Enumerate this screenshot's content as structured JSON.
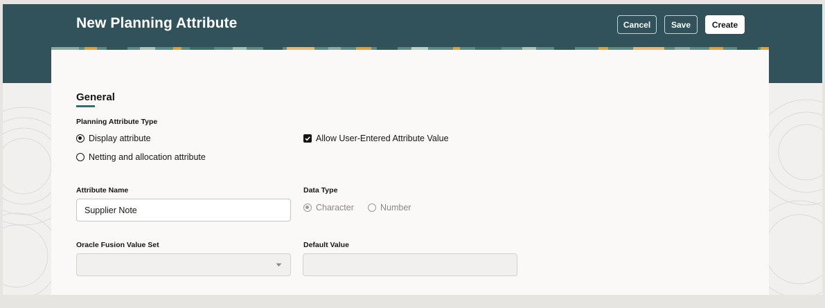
{
  "header": {
    "title": "New Planning Attribute",
    "buttons": {
      "cancel": "Cancel",
      "save": "Save",
      "create": "Create"
    }
  },
  "general": {
    "section_title": "General",
    "planning_attribute_type": {
      "label": "Planning Attribute Type",
      "options": [
        {
          "label": "Display attribute",
          "selected": true
        },
        {
          "label": "Netting and allocation attribute",
          "selected": false
        }
      ]
    },
    "allow_user_entered": {
      "label": "Allow User-Entered Attribute Value",
      "checked": true
    },
    "attribute_name": {
      "label": "Attribute Name",
      "value": "Supplier Note"
    },
    "data_type": {
      "label": "Data Type",
      "options": [
        {
          "label": "Character",
          "selected": true
        },
        {
          "label": "Number",
          "selected": false
        }
      ],
      "disabled": true
    },
    "value_set": {
      "label": "Oracle Fusion Value Set",
      "value": ""
    },
    "default_value": {
      "label": "Default Value",
      "value": ""
    }
  },
  "colors": {
    "header_bg": "#31525a",
    "accent_underline": "#3d6a72",
    "card_bg": "#fbf9f8",
    "page_bg": "#f1f0ee"
  }
}
